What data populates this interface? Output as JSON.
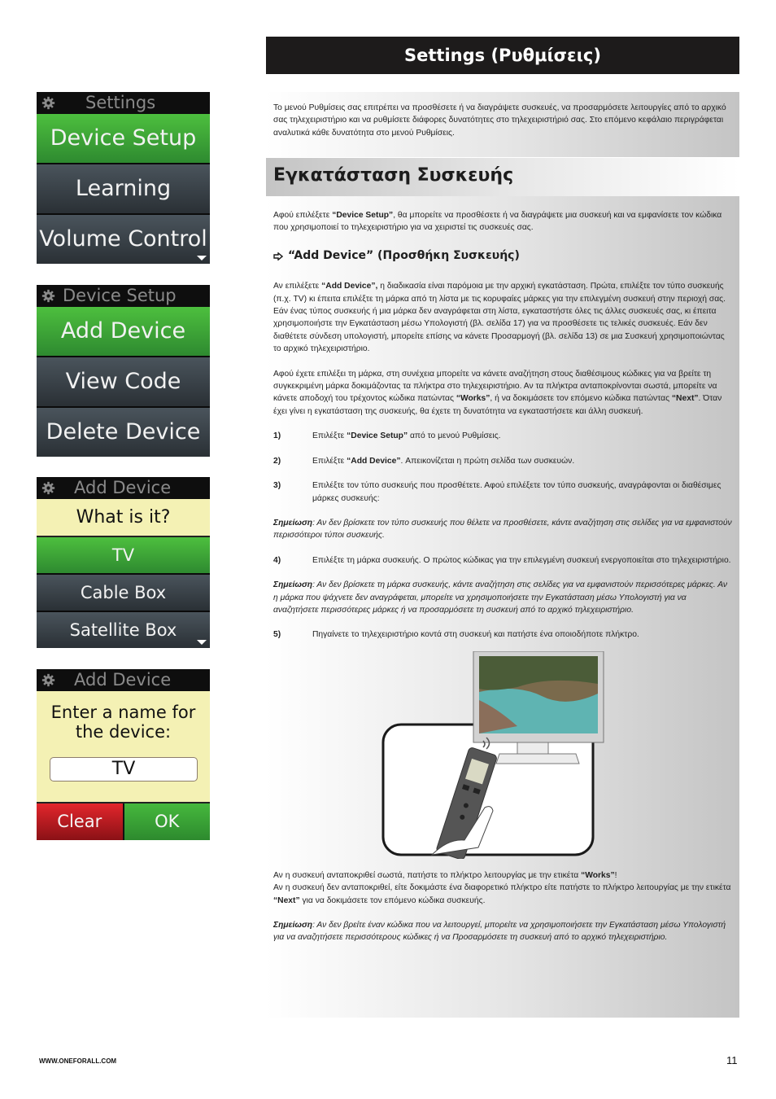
{
  "screens": [
    {
      "title": "Settings",
      "items": [
        {
          "label": "Device Setup",
          "selected": true
        },
        {
          "label": "Learning",
          "selected": false
        },
        {
          "label": "Volume Control",
          "selected": false,
          "more": true
        }
      ]
    },
    {
      "title": "Device Setup",
      "items": [
        {
          "label": "Add Device",
          "selected": true
        },
        {
          "label": "View Code",
          "selected": false
        },
        {
          "label": "Delete Device",
          "selected": false
        }
      ]
    },
    {
      "title": "Add Device",
      "prompt": "What is it?",
      "items": [
        {
          "label": "TV",
          "selected": true
        },
        {
          "label": "Cable Box",
          "selected": false
        },
        {
          "label": "Satellite Box",
          "selected": false,
          "more": true
        }
      ]
    },
    {
      "title": "Add Device",
      "prompt_line1": "Enter a name for",
      "prompt_line2": "the device:",
      "name_value": "TV",
      "clear_label": "Clear",
      "ok_label": "OK"
    }
  ],
  "header": {
    "title": "Settings (Ρυθμίσεις)"
  },
  "intro": "Το μενού Ρυθμίσεις σας επιτρέπει να προσθέσετε ή να διαγράψετε συσκευές, να προσαρμόσετε λειτουργίες από το αρχικό σας τηλεχειριστήριο και να ρυθμίσετε διάφορες δυνατότητες στο τηλεχειριστήριό σας. Στο επόμενο κεφάλαιο περιγράφεται αναλυτικά κάθε δυνατότητα στο μενού Ρυθμίσεις.",
  "section": {
    "title": "Εγκατάσταση Συσκευής",
    "p1_before": "Αφού επιλέξετε ",
    "p1_bold": "“Device Setup”",
    "p1_after": ", θα μπορείτε να προσθέσετε ή να διαγράψετε μια συσκευή και να εμφανίσετε τον κώδικα που χρησιμοποιεί το τηλεχειριστήριο για να χειριστεί τις συσκευές σας.",
    "subheading": "“Add Device” (Προσθήκη Συσκευής)",
    "p2_before": "Αν επιλέξετε ",
    "p2_bold": "“Add Device”,",
    "p2_after": " η διαδικασία είναι παρόμοια με την αρχική εγκατάσταση. Πρώτα, επιλέξτε τον τύπο συσκευής (π.χ. TV) κι έπειτα επιλέξτε τη μάρκα από τη λίστα με τις κορυφαίες μάρκες για την επιλεγμένη συσκευή στην περιοχή σας. Εάν ένας τύπος συσκευής ή μια μάρκα δεν αναγράφεται στη λίστα, εγκαταστήστε όλες τις άλλες συσκευές σας, κι έπειτα χρησιμοποιήστε την Εγκατάσταση μέσω Υπολογιστή (βλ. σελίδα 17) για να προσθέσετε τις τελικές συσκευές. Εάν δεν διαθέτετε σύνδεση υπολογιστή, μπορείτε επίσης να κάνετε Προσαρμογή (βλ. σελίδα 13) σε μια Συσκευή χρησιμοποιώντας το αρχικό τηλεχειριστήριο.",
    "p3_a": "Αφού έχετε επιλέξει τη μάρκα, στη συνέχεια μπορείτε να κάνετε αναζήτηση στους διαθέσιμους κώδικες για να βρείτε τη συγκεκριμένη μάρκα δοκιμάζοντας τα πλήκτρα στο τηλεχειριστήριο. Αν τα πλήκτρα ανταποκρίνονται σωστά, μπορείτε να κάνετε αποδοχή του τρέχοντος κώδικα πατώντας ",
    "p3_works": "“Works”",
    "p3_b": ", ή να δοκιμάσετε τον επόμενο κώδικα πατώντας ",
    "p3_next": "“Next”",
    "p3_c": ". Όταν έχει γίνει η εγκατάσταση της συσκευής, θα έχετε τη δυνατότητα να εγκαταστήσετε και άλλη συσκευή.",
    "steps": [
      {
        "num": "1)",
        "before": "Επιλέξτε ",
        "bold": "“Device Setup”",
        "after": " από το μενού Ρυθμίσεις."
      },
      {
        "num": "2)",
        "before": "Επιλέξτε ",
        "bold": "“Add Device”",
        "after": ". Απεικονίζεται η πρώτη σελίδα των συσκευών."
      },
      {
        "num": "3)",
        "before": "Επιλέξτε τον τύπο συσκευής που προσθέτετε. Αφού επιλέξετε τον τύπο συσκευής, αναγράφονται οι διαθέσιμες μάρκες συσκευής:",
        "bold": "",
        "after": ""
      },
      {
        "num": "4)",
        "before": "Επιλέξτε τη μάρκα συσκευής. Ο πρώτος κώδικας για την επιλεγμένη συσκευή ενεργοποιείται στο τηλεχειριστήριο.",
        "bold": "",
        "after": ""
      },
      {
        "num": "5)",
        "before": "Πηγαίνετε το τηλεχειριστήριο κοντά στη συσκευή και πατήστε ένα οποιοδήποτε πλήκτρο.",
        "bold": "",
        "after": ""
      }
    ],
    "note_label": "Σημείωση",
    "note1": ": Αν δεν βρίσκετε τον τύπο συσκευής που θέλετε να προσθέσετε, κάντε αναζήτηση στις σελίδες για να εμφανιστούν περισσότεροι τύποι συσκευής.",
    "note2": ": Αν δεν βρίσκετε τη μάρκα συσκευής, κάντε αναζήτηση στις σελίδες για να εμφανιστούν περισσότερες μάρκες.  Αν η μάρκα που ψάχνετε δεν αναγράφεται, μπορείτε να χρησιμοποιήσετε την Εγκατάσταση μέσω Υπολογιστή για να αναζητήσετε περισσότερες μάρκες ή να προσαρμόσετε τη συσκευή από το αρχικό τηλεχειριστήριο.",
    "p4_a": "Αν η συσκευή ανταποκριθεί σωστά, πατήστε το πλήκτρο λειτουργίας με την ετικέτα ",
    "p4_works": "“Works”",
    "p4_b": "!",
    "p5_a": "Αν η συσκευή δεν ανταποκριθεί, είτε δοκιμάστε ένα διαφορετικό πλήκτρο είτε πατήστε το πλήκτρο λειτουργίας με την ετικέτα ",
    "p5_next": "“Next”",
    "p5_b": " για να δοκιμάσετε τον επόμενο κώδικα συσκευής.",
    "note3": ": Αν δεν βρείτε έναν κώδικα που να λειτουργεί, μπορείτε να χρησιμοποιήσετε την Εγκατάσταση μέσω Υπολογιστή για να αναζητήσετε περισσότερους κώδικες ή να Προσαρμόσετε τη συσκευή από το αρχικό τηλεχειριστήριο."
  },
  "illustration": {
    "icon": "remote-pointing-at-tv-illustration"
  },
  "footer": {
    "url": "WWW.ONEFORALL.COM",
    "page": "11"
  },
  "colors": {
    "selected_green": "#3fa93a",
    "item_dark": "#323a40",
    "prompt_yellow": "#f4f1b4",
    "clear_red": "#c01c22",
    "header_black": "#1d1b1b"
  }
}
